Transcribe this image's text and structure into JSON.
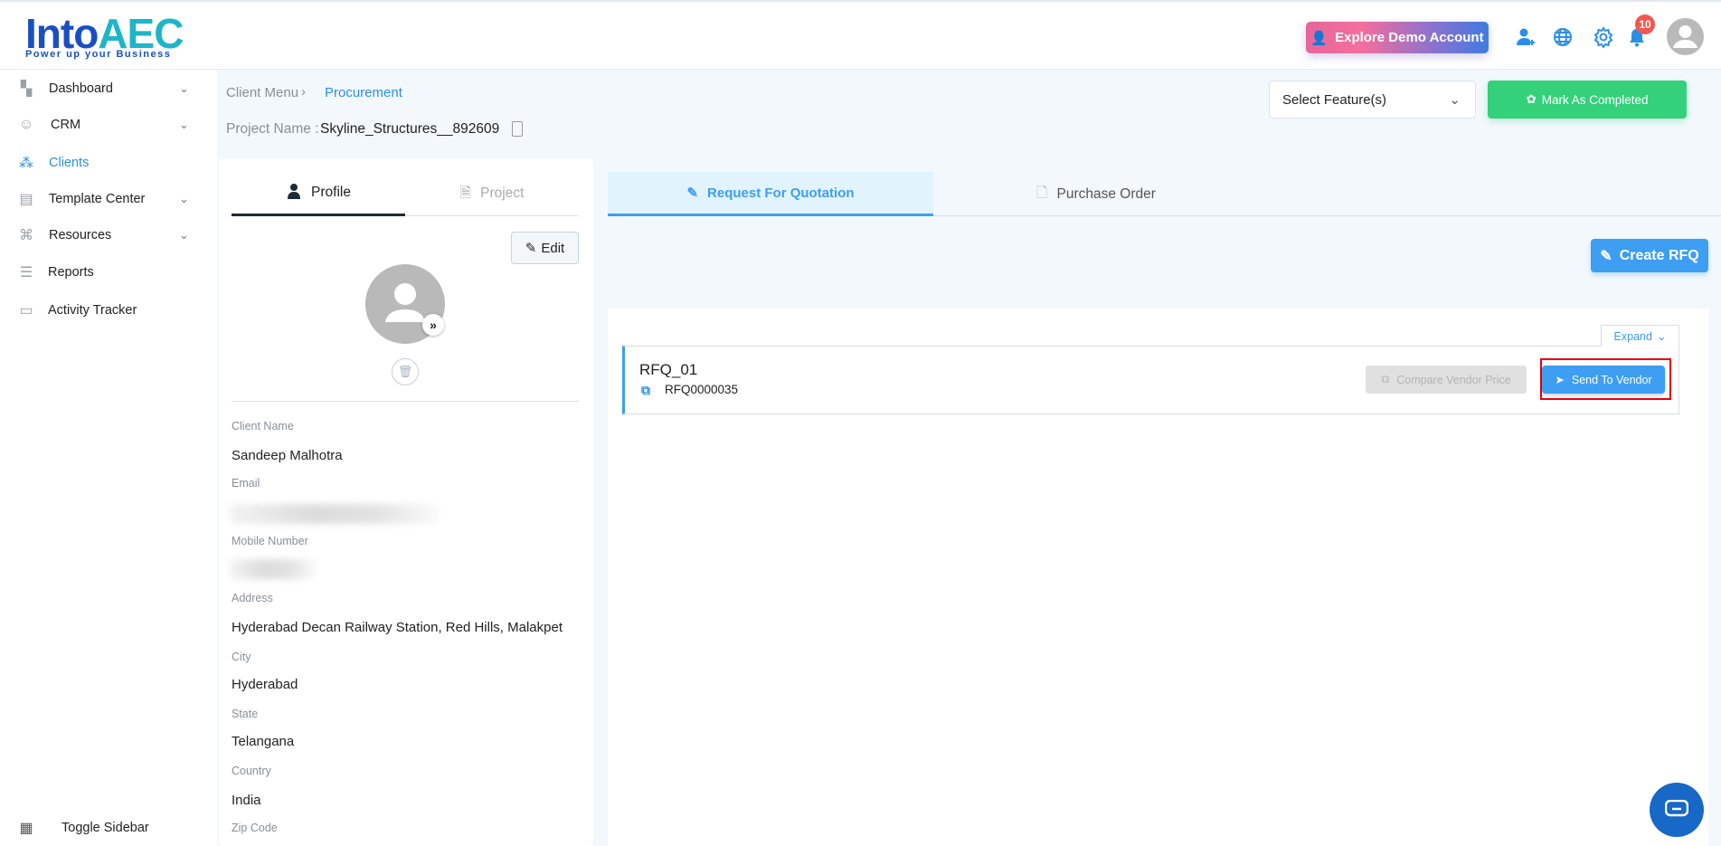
{
  "header": {
    "logo_text": "IntoAEC",
    "logo_tagline": "Power up your Business",
    "explore_label": "Explore Demo Account",
    "notification_count": "10"
  },
  "sidebar": {
    "items": [
      {
        "label": "Dashboard"
      },
      {
        "label": "CRM"
      },
      {
        "label": "Clients"
      },
      {
        "label": "Template Center"
      },
      {
        "label": "Resources"
      },
      {
        "label": "Reports"
      },
      {
        "label": "Activity Tracker"
      }
    ],
    "toggle_label": "Toggle Sidebar"
  },
  "breadcrumb": {
    "parent": "Client Menu",
    "current": "Procurement"
  },
  "project": {
    "label": "Project Name :",
    "name": "Skyline_Structures__892609"
  },
  "toolbar": {
    "select_placeholder": "Select Feature(s)",
    "mark_completed": "Mark As Completed"
  },
  "profile_card": {
    "tabs": [
      "Profile",
      "Project"
    ],
    "edit_label": "Edit",
    "fields": [
      {
        "label": "Client Name",
        "value": "Sandeep Malhotra"
      },
      {
        "label": "Email",
        "value": ""
      },
      {
        "label": "Mobile Number",
        "value": ""
      },
      {
        "label": "Address",
        "value": "Hyderabad Decan Railway Station, Red Hills, Malakpet"
      },
      {
        "label": "City",
        "value": "Hyderabad"
      },
      {
        "label": "State",
        "value": "Telangana"
      },
      {
        "label": "Country",
        "value": "India"
      },
      {
        "label": "Zip Code",
        "value": ""
      }
    ]
  },
  "main": {
    "tabs": [
      "Request For Quotation",
      "Purchase Order"
    ],
    "create_rfq": "Create RFQ",
    "expand_label": "Expand",
    "rfq": {
      "name": "RFQ_01",
      "code": "RFQ0000035",
      "compare_label": "Compare Vendor Price",
      "send_label": "Send To Vendor"
    }
  },
  "colors": {
    "accent": "#3d9ef2",
    "success": "#33d17a",
    "highlight": "#e8000b"
  }
}
